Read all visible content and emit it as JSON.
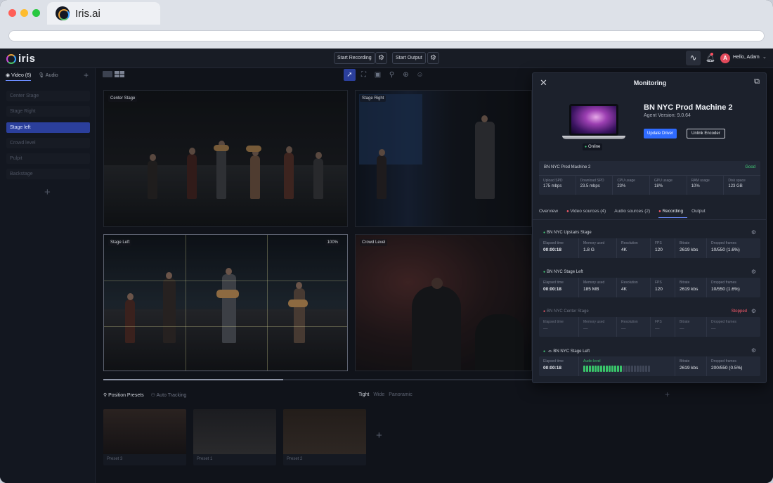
{
  "browser": {
    "tab_title": "Iris.ai",
    "traffic_colors": [
      "#ff5f57",
      "#febc2e",
      "#28c840"
    ]
  },
  "topbar": {
    "brand": "iris",
    "start_recording": "Start Recording",
    "start_output": "Start Output",
    "greeting": "Hello, Adam",
    "avatar_initial": "A"
  },
  "sidebar": {
    "tabs": [
      {
        "label": "Video (6)",
        "active": true
      },
      {
        "label": "Audio",
        "active": false
      }
    ],
    "items": [
      {
        "label": "Center Stage",
        "active": false
      },
      {
        "label": "Stage Right",
        "active": false
      },
      {
        "label": "Stage left",
        "active": true
      },
      {
        "label": "Crowd level",
        "active": false
      },
      {
        "label": "Pulpit",
        "active": false
      },
      {
        "label": "Backstage",
        "active": false
      }
    ]
  },
  "feeds": [
    {
      "label": "Center Stage"
    },
    {
      "label": "Stage Right"
    },
    {
      "label": "Stage Left",
      "zoom": "100%"
    },
    {
      "label": "Crowd Level"
    }
  ],
  "presets": {
    "tabs": [
      {
        "label": "Position Presets",
        "active": true
      },
      {
        "label": "Auto Tracking",
        "active": false
      }
    ],
    "modes": [
      {
        "label": "Tight",
        "active": true
      },
      {
        "label": "Wide",
        "active": false
      },
      {
        "label": "Panoramic",
        "active": false
      }
    ],
    "items": [
      {
        "label": "Preset 3"
      },
      {
        "label": "Preset 1"
      },
      {
        "label": "Preset 2"
      }
    ]
  },
  "monitoring": {
    "title": "Monitoring",
    "machine": "BN NYC Prod Machine 2",
    "agent_version": "Agent Version: 9.0.64",
    "status": "Online",
    "update_driver": "Update Driver",
    "unlink_encoder": "Unlink Encoder",
    "summary": {
      "name": "BN NYC Prod Machine 2",
      "health": "Good",
      "stats": [
        {
          "k": "Upload SPD",
          "v": "175 mbps"
        },
        {
          "k": "Download SPD",
          "v": "23.5 mbps"
        },
        {
          "k": "CPU usage",
          "v": "23%"
        },
        {
          "k": "GPU usage",
          "v": "18%"
        },
        {
          "k": "RAM usage",
          "v": "10%"
        },
        {
          "k": "Disk space",
          "v": "123 GB"
        }
      ]
    },
    "tabs": [
      {
        "label": "Overview",
        "active": false,
        "dot": false
      },
      {
        "label": "Video sources (4)",
        "active": false,
        "dot": true
      },
      {
        "label": "Audio sources (2)",
        "active": false,
        "dot": false
      },
      {
        "label": "Recording",
        "active": true,
        "dot": true
      },
      {
        "label": "Output",
        "active": false,
        "dot": false
      }
    ],
    "recordings": [
      {
        "name": "BN NYC Upstairs Stage",
        "state": "running",
        "cells": [
          {
            "k": "Elapsed time",
            "v": "00:00:18"
          },
          {
            "k": "Memory used",
            "v": "1.8 G"
          },
          {
            "k": "Resolution",
            "v": "4K"
          },
          {
            "k": "FPS",
            "v": "120"
          },
          {
            "k": "Bitrate",
            "v": "2619 kbs"
          },
          {
            "k": "Dropped frames",
            "v": "10/550 (1.6%)"
          }
        ]
      },
      {
        "name": "BN NYC Stage Left",
        "state": "running",
        "cells": [
          {
            "k": "Elapsed time",
            "v": "00:00:18"
          },
          {
            "k": "Memory used",
            "v": "185 MB"
          },
          {
            "k": "Resolution",
            "v": "4K"
          },
          {
            "k": "FPS",
            "v": "120"
          },
          {
            "k": "Bitrate",
            "v": "2619 kbs"
          },
          {
            "k": "Dropped frames",
            "v": "10/550 (1.6%)"
          }
        ]
      },
      {
        "name": "BN NYC Center Stage",
        "state": "stopped",
        "state_label": "Stopped",
        "cells": [
          {
            "k": "Elapsed time",
            "v": "—"
          },
          {
            "k": "Memory used",
            "v": "—"
          },
          {
            "k": "Resolution",
            "v": "—"
          },
          {
            "k": "FPS",
            "v": "—"
          },
          {
            "k": "Bitrate",
            "v": "—"
          },
          {
            "k": "Dropped frames",
            "v": "—"
          }
        ]
      }
    ],
    "audio_recording": {
      "name": "BN NYC Stage Left",
      "elapsed_k": "Elapsed time",
      "elapsed_v": "00:00:18",
      "level_k": "Audio level",
      "level_fraction": 0.58,
      "bitrate_k": "Bitrate",
      "bitrate_v": "2619 kbs",
      "dropped_k": "Dropped frames",
      "dropped_v": "200/550 (0.5%)"
    }
  }
}
